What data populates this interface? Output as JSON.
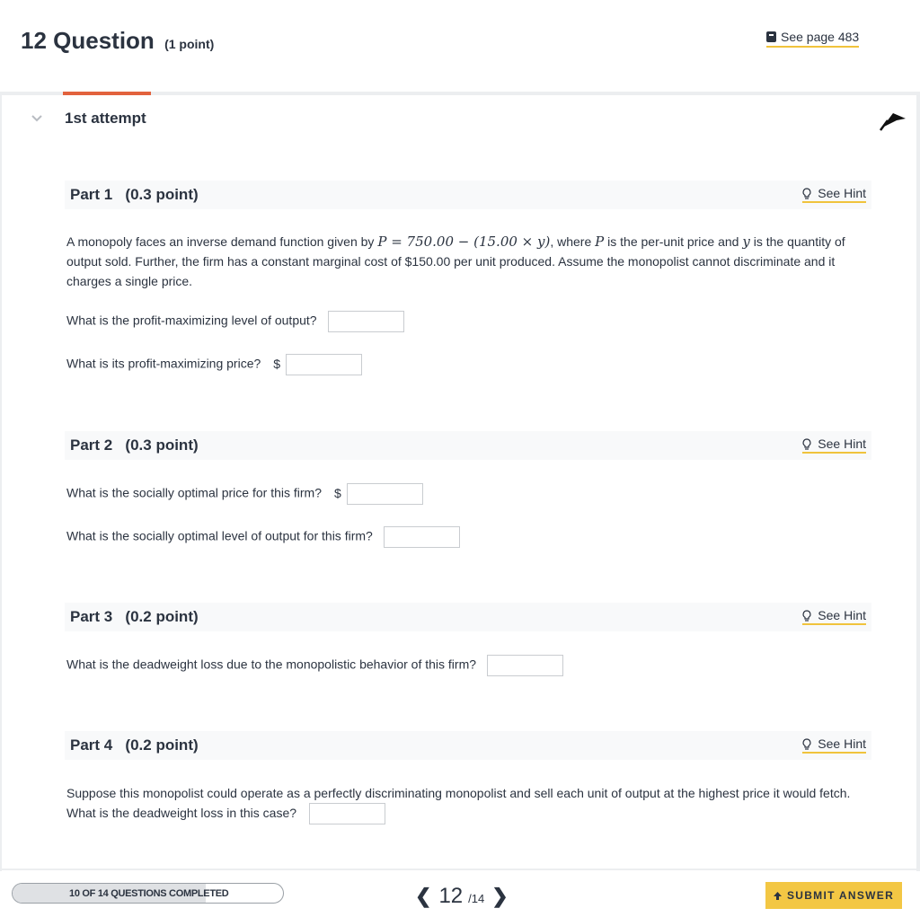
{
  "header": {
    "question_title": "12 Question",
    "points": "(1 point)",
    "see_page": "See page 483",
    "book_icon": "book-icon"
  },
  "attempt": {
    "label": "1st attempt"
  },
  "parts": [
    {
      "title": "Part 1",
      "points": "(0.3 point)",
      "hint": "See Hint",
      "intro_a": "A monopoly faces an inverse demand function given by ",
      "math_a": "P = 750.00 − (15.00 × y)",
      "intro_b": ", where ",
      "math_b": "P",
      "intro_c": " is the per-unit price and ",
      "math_c": "y",
      "intro_d": " is the quantity of output sold. Further, the firm has a constant marginal cost of $150.00 per unit produced. Assume the monopolist cannot discriminate and it charges a single price.",
      "q1": "What is the profit-maximizing level of output?",
      "q2": "What is its profit-maximizing price?",
      "q2_prefix": "$"
    },
    {
      "title": "Part 2",
      "points": "(0.3 point)",
      "hint": "See Hint",
      "q1": "What is the socially optimal price for this firm?",
      "q1_prefix": "$",
      "q2": "What is the socially optimal level of output for this firm?"
    },
    {
      "title": "Part 3",
      "points": "(0.2 point)",
      "hint": "See Hint",
      "q1": "What is the deadweight loss due to the monopolistic behavior of this firm?"
    },
    {
      "title": "Part 4",
      "points": "(0.2 point)",
      "hint": "See Hint",
      "q1": "Suppose this monopolist could operate as a perfectly discriminating monopolist and sell each unit of output at the highest price it would fetch. What is the deadweight loss in this case?"
    }
  ],
  "footer": {
    "progress_text": "10 OF 14 QUESTIONS COMPLETED",
    "progress_fraction": 0.714,
    "current": "12",
    "total": "/14",
    "prev_icon": "chevron-left-icon",
    "next_icon": "chevron-right-icon",
    "submit_label": "SUBMIT ANSWER"
  },
  "colors": {
    "accent_tab": "#e2623d",
    "link_underline": "#f0c33c",
    "submit_bg": "#f3c744",
    "text": "#2b3340"
  }
}
